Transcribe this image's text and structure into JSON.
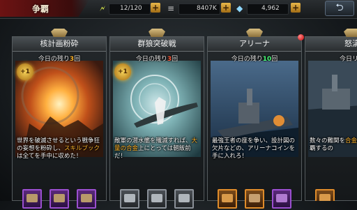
{
  "header": {
    "title": "争覇",
    "stamina": "12/120",
    "silver": "8407K",
    "diamonds": "4,962",
    "plus_label": "+",
    "back_label": "⮌"
  },
  "cards": [
    {
      "name": "核計画粉砕",
      "remaining_prefix": "今日の残り",
      "remaining_count": "3",
      "remaining_suffix": "回",
      "badge": "+1",
      "desc_a": "世界を破滅させるという戦争狂の妄想を粉砕し、",
      "desc_hl": "スキルブック",
      "desc_b": "は全てを手中に収めた！",
      "reward_color": "purple"
    },
    {
      "name": "群狼突破戦",
      "remaining_prefix": "今日の残り",
      "remaining_count": "3",
      "remaining_suffix": "回",
      "badge": "+1",
      "desc_a": "敵軍の潜水艦を殲滅すれば、",
      "desc_hl": "大量の合金",
      "desc_b": "上にとっては朝飯前だ！",
      "reward_color": "grey"
    },
    {
      "name": "アリーナ",
      "remaining_prefix": "今日の残り",
      "remaining_count": "10",
      "remaining_suffix": "回",
      "badge": "",
      "desc_a": "",
      "desc_hl": "",
      "desc_b": "最強王者の座を争い、設計図の欠片などの、アリーナコインを手に入れろ！",
      "reward_color": "orange"
    },
    {
      "name": "怒濤",
      "remaining_prefix": "今日",
      "remaining_count": "",
      "remaining_suffix": "リセ",
      "badge": "",
      "desc_a": "数々の難関を",
      "desc_hl": "合金",
      "desc_b": "を勝ち取れ 制覇するの",
      "reward_color": "orange"
    }
  ]
}
